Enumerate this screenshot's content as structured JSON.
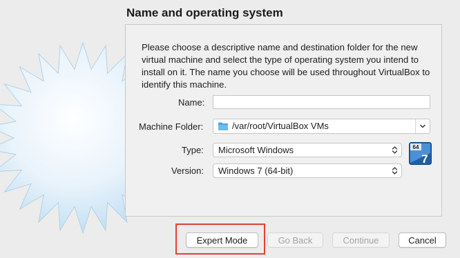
{
  "page": {
    "title": "Name and operating system",
    "description": "Please choose a descriptive name and destination folder for the new virtual machine and select the type of operating system you intend to install on it. The name you choose will be used throughout VirtualBox to identify this machine."
  },
  "form": {
    "name_label": "Name:",
    "name_value": "",
    "folder_label": "Machine Folder:",
    "folder_value": "/var/root/VirtualBox VMs",
    "type_label": "Type:",
    "type_value": "Microsoft Windows",
    "version_label": "Version:",
    "version_value": "Windows 7 (64-bit)",
    "os_badge": {
      "bits": "64",
      "version": "7"
    }
  },
  "buttons": {
    "expert_mode": "Expert Mode",
    "go_back": "Go Back",
    "continue": "Continue",
    "cancel": "Cancel"
  },
  "colors": {
    "highlight": "#e2412e",
    "starburst": "#cfe6f6",
    "folder": "#4aa3e0"
  },
  "icons": [
    "starburst-graphic",
    "folder-icon",
    "chevron-down-icon",
    "updown-icon",
    "windows-7-64bit-icon"
  ]
}
